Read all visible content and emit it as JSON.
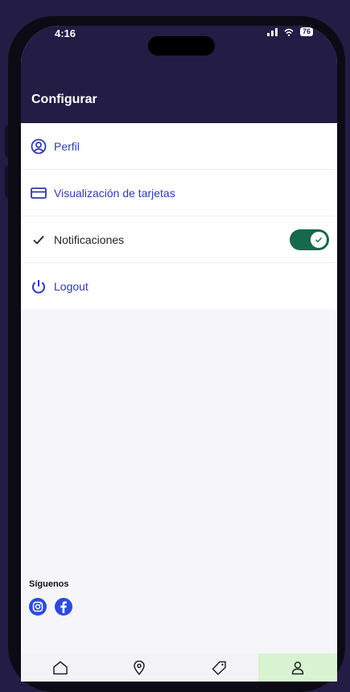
{
  "status_bar": {
    "time": "4:16",
    "battery": "76"
  },
  "header": {
    "title": "Configurar"
  },
  "menu": {
    "items": [
      {
        "label": "Perfil",
        "icon": "user-circle-icon"
      },
      {
        "label": "Visualización de tarjetas",
        "icon": "card-icon"
      },
      {
        "label": "Notificaciones",
        "icon": "check-icon",
        "toggle_on": true
      },
      {
        "label": "Logout",
        "icon": "power-icon"
      }
    ]
  },
  "social": {
    "title": "Síguenos",
    "icons": [
      "instagram-icon",
      "facebook-icon"
    ]
  },
  "tabs": [
    {
      "icon": "home-icon",
      "active": false
    },
    {
      "icon": "map-pin-icon",
      "active": false
    },
    {
      "icon": "tag-icon",
      "active": false
    },
    {
      "icon": "profile-icon",
      "active": true
    }
  ],
  "colors": {
    "header_bg": "#231c45",
    "link_blue": "#2d3aa8",
    "toggle_green": "#17694b",
    "active_tab": "#d8f3d2",
    "social_blue": "#2d4bd8"
  }
}
